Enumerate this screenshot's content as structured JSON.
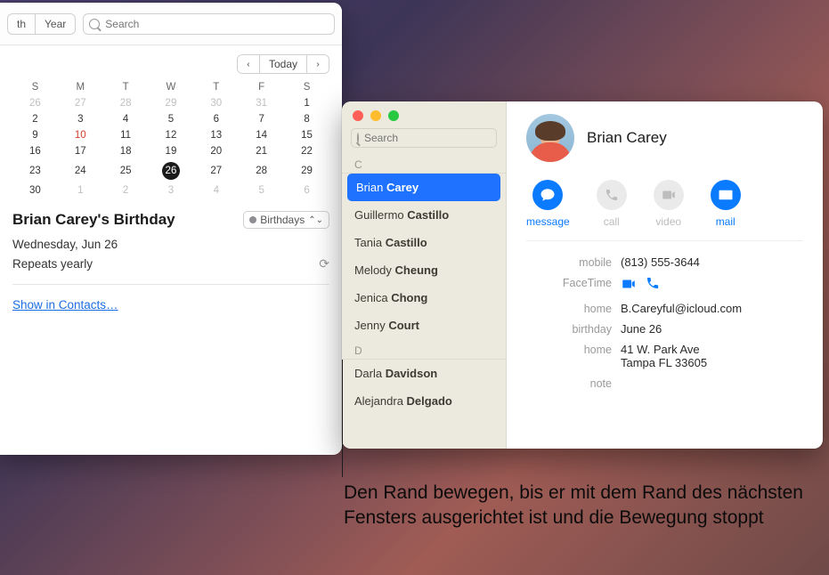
{
  "calendar": {
    "tabs": [
      "th",
      "Year"
    ],
    "search_placeholder": "Search",
    "nav": {
      "prev": "‹",
      "today": "Today",
      "next": "›"
    },
    "dow": [
      "S",
      "M",
      "T",
      "W",
      "T",
      "F",
      "S"
    ],
    "grid": [
      [
        {
          "n": "26",
          "dim": true
        },
        {
          "n": "27",
          "dim": true
        },
        {
          "n": "28",
          "dim": true
        },
        {
          "n": "29",
          "dim": true
        },
        {
          "n": "30",
          "dim": true
        },
        {
          "n": "31",
          "dim": true
        },
        {
          "n": "1"
        }
      ],
      [
        {
          "n": "2"
        },
        {
          "n": "3"
        },
        {
          "n": "4"
        },
        {
          "n": "5"
        },
        {
          "n": "6"
        },
        {
          "n": "7"
        },
        {
          "n": "8"
        }
      ],
      [
        {
          "n": "9"
        },
        {
          "n": "10",
          "red": true
        },
        {
          "n": "11"
        },
        {
          "n": "12"
        },
        {
          "n": "13"
        },
        {
          "n": "14"
        },
        {
          "n": "15"
        }
      ],
      [
        {
          "n": "16"
        },
        {
          "n": "17"
        },
        {
          "n": "18"
        },
        {
          "n": "19"
        },
        {
          "n": "20"
        },
        {
          "n": "21"
        },
        {
          "n": "22"
        }
      ],
      [
        {
          "n": "23"
        },
        {
          "n": "24"
        },
        {
          "n": "25"
        },
        {
          "n": "26",
          "sel": true
        },
        {
          "n": "27"
        },
        {
          "n": "28"
        },
        {
          "n": "29"
        }
      ],
      [
        {
          "n": "30"
        },
        {
          "n": "1",
          "dim": true
        },
        {
          "n": "2",
          "dim": true
        },
        {
          "n": "3",
          "dim": true
        },
        {
          "n": "4",
          "dim": true
        },
        {
          "n": "5",
          "dim": true
        },
        {
          "n": "6",
          "dim": true
        }
      ]
    ],
    "event": {
      "title": "Brian Carey's Birthday",
      "calendar_chip": "Birthdays",
      "date": "Wednesday, Jun 26",
      "repeat": "Repeats yearly",
      "link": "Show in Contacts…"
    }
  },
  "contacts": {
    "search_placeholder": "Search",
    "sections": [
      {
        "letter": "C",
        "items": [
          {
            "first": "Brian",
            "last": "Carey",
            "selected": true
          },
          {
            "first": "Guillermo",
            "last": "Castillo"
          },
          {
            "first": "Tania",
            "last": "Castillo"
          },
          {
            "first": "Melody",
            "last": "Cheung"
          },
          {
            "first": "Jenica",
            "last": "Chong"
          },
          {
            "first": "Jenny",
            "last": "Court"
          }
        ]
      },
      {
        "letter": "D",
        "items": [
          {
            "first": "Darla",
            "last": "Davidson"
          },
          {
            "first": "Alejandra",
            "last": "Delgado"
          }
        ]
      }
    ],
    "detail": {
      "name": "Brian Carey",
      "actions": [
        {
          "label": "message",
          "enabled": true,
          "icon": "message"
        },
        {
          "label": "call",
          "enabled": false,
          "icon": "phone"
        },
        {
          "label": "video",
          "enabled": false,
          "icon": "video"
        },
        {
          "label": "mail",
          "enabled": true,
          "icon": "mail"
        }
      ],
      "fields": [
        {
          "label": "mobile",
          "value": "(813) 555-3644"
        },
        {
          "label": "FaceTime",
          "value": "",
          "ft": true
        },
        {
          "label": "home",
          "value": "B.Careyful@icloud.com"
        },
        {
          "label": "birthday",
          "value": "June 26"
        },
        {
          "label": "home",
          "value": "41 W. Park Ave\nTampa FL 33605"
        },
        {
          "label": "note",
          "value": ""
        }
      ]
    }
  },
  "callout": "Den Rand bewegen, bis er mit dem Rand des nächsten Fensters ausgerichtet ist und die Bewegung stoppt"
}
